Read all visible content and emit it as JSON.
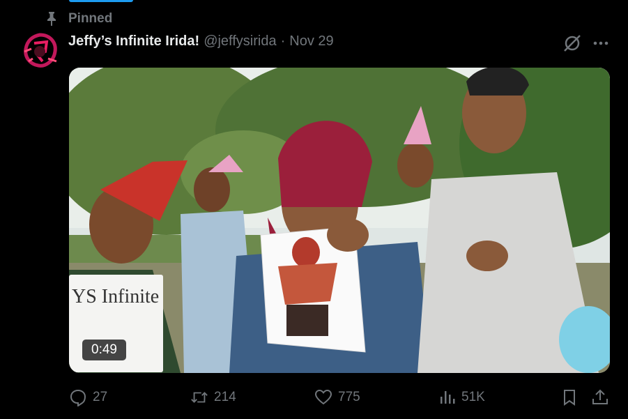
{
  "pinned": {
    "label": "Pinned",
    "icon": "pin-icon"
  },
  "author": {
    "display_name": "Jeffy’s Infinite Irida!",
    "handle": "@jeffysirida",
    "separator": "·",
    "date": "Nov 29"
  },
  "media": {
    "duration": "0:49",
    "sign_text": "YS Infinite"
  },
  "actions": {
    "replies": "27",
    "reposts": "214",
    "likes": "775",
    "views": "51K"
  },
  "colors": {
    "background": "#000000",
    "muted_text": "#71767b",
    "primary_text": "#e7e9ea",
    "accent": "#1d9bf0"
  }
}
